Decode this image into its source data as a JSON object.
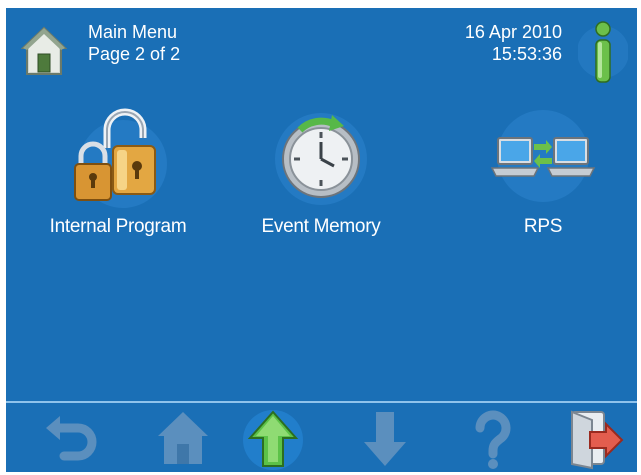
{
  "header": {
    "title": "Main Menu",
    "page_info": "Page 2 of 2",
    "date": "16 Apr 2010",
    "time": "15:53:36"
  },
  "menu": {
    "items": [
      {
        "label": "Internal Program",
        "icon": "padlock-icon"
      },
      {
        "label": "Event Memory",
        "icon": "clock-history-icon"
      },
      {
        "label": "RPS",
        "icon": "computers-link-icon"
      }
    ]
  },
  "nav": {
    "buttons": [
      "back-icon",
      "home-icon",
      "up-arrow-icon",
      "down-arrow-icon",
      "help-icon",
      "exit-icon"
    ],
    "active": "up-arrow-icon"
  },
  "colors": {
    "background": "#1a6fb6",
    "text": "#ffffff",
    "accent_green": "#4fb84a",
    "disabled_icon": "#5b8fbe",
    "exit_red": "#e35d4e"
  }
}
